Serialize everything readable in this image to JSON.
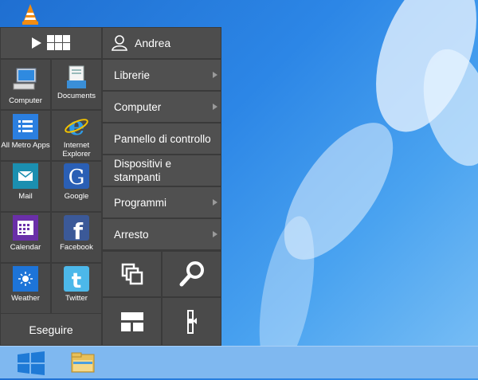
{
  "user": {
    "name": "Andrea"
  },
  "tiles": [
    {
      "label": "Computer",
      "icon": "computer-icon"
    },
    {
      "label": "Documents",
      "icon": "documents-icon"
    },
    {
      "label": "All Metro Apps",
      "icon": "all-apps-icon"
    },
    {
      "label": "Internet Explorer",
      "icon": "internet-explorer-icon"
    },
    {
      "label": "Mail",
      "icon": "mail-icon"
    },
    {
      "label": "Google",
      "icon": "google-icon"
    },
    {
      "label": "Calendar",
      "icon": "calendar-icon"
    },
    {
      "label": "Facebook",
      "icon": "facebook-icon"
    },
    {
      "label": "Weather",
      "icon": "weather-icon"
    },
    {
      "label": "Twitter",
      "icon": "twitter-icon"
    }
  ],
  "menu": [
    {
      "label": "Librerie",
      "has_submenu": true
    },
    {
      "label": "Computer",
      "has_submenu": true
    },
    {
      "label": "Pannello di controllo",
      "has_submenu": false
    },
    {
      "label": "Dispositivi e stampanti",
      "has_submenu": false
    },
    {
      "label": "Programmi",
      "has_submenu": true
    },
    {
      "label": "Arresto",
      "has_submenu": true
    }
  ],
  "actions": [
    {
      "icon": "switch-windows-icon"
    },
    {
      "icon": "search-icon"
    },
    {
      "icon": "start-screen-icon"
    },
    {
      "icon": "pin-icon"
    }
  ],
  "run_label": "Eseguire",
  "colors": {
    "menu_bg": "#3a3a3a",
    "tile_bg": "#484848",
    "desktop": "#2c86e6",
    "taskbar": "#7fb8f0"
  }
}
